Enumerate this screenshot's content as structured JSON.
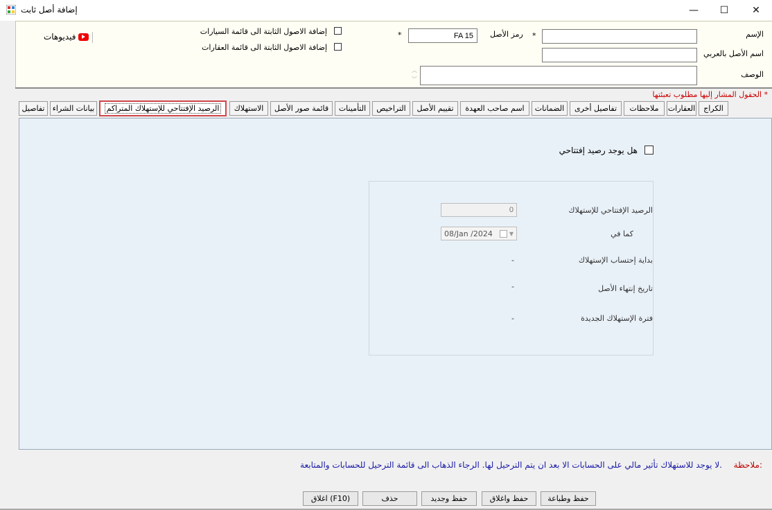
{
  "window": {
    "title": "إضافة أصل ثابت",
    "min": "—",
    "max": "☐",
    "close": "✕"
  },
  "header": {
    "name_label": "الإسم",
    "name_value": "",
    "arabic_name_label": "اسم الأصل بالعربي",
    "arabic_name_value": "",
    "description_label": "الوصف",
    "description_value": "",
    "asset_code_label": "رمز الأصل",
    "asset_code_value": "FA 15",
    "required_star": "*",
    "add_to_cars_label": "إضافة الاصول الثابتة الى قائمة السيارات",
    "add_to_realestate_label": "إضافة الاصول الثابتة الى قائمة العقارات",
    "videos_label": "فيديوهات"
  },
  "required_note": "الحقول المشار إليها مطلوب تعبئتها *",
  "tabs": [
    "الكراج",
    "العقارات",
    "ملاحظات",
    "تفاصيل أخرى",
    "الضمانات",
    "اسم صاحب العهدة",
    "تقييم الأصل",
    "التراخيص",
    "التأمينات",
    "قائمة صور الأصل",
    "الاستهلاك",
    "الرصيد الإفتتاحي للإستهلاك المتراكم",
    "بيانات الشراء",
    "تفاصيل"
  ],
  "content": {
    "has_opening_balance_label": "هل يوجد رصيد إفتتاحي",
    "opening_balance_label": "الرصيد الإفتتاحي للإستهلاك",
    "opening_balance_value": "0",
    "as_of_label": "كما في",
    "as_of_value": "08/Jan /2024",
    "depreciation_start_label": "بداية إحتساب الإستهلاك",
    "depreciation_start_value": "-",
    "asset_end_date_label": "تاريخ إنتهاء الأصل",
    "asset_end_date_value": "-",
    "new_depreciation_period_label": "فترة الإستهلاك الجديدة",
    "new_depreciation_period_value": "-"
  },
  "note": {
    "prefix": "ملاحظة:",
    "text": "لا يوجد للاستهلاك تأثير مالي على الحسابات الا بعد ان يتم الترحيل لها. الرجاء الذهاب الى قائمة الترحيل للحسابات والمتابعة."
  },
  "buttons": {
    "save_print": "حفظ وطباعة",
    "save_close": "حفظ واغلاق",
    "save_new": "حفظ وجديد",
    "delete": "حذف",
    "close": "اغلاق (F10)"
  },
  "colors": {
    "accent_red": "#d0474b",
    "note_blue": "#1a1aa6",
    "note_red": "#c00000",
    "content_bg": "#e9f1f8",
    "header_bg": "#fffef4"
  }
}
